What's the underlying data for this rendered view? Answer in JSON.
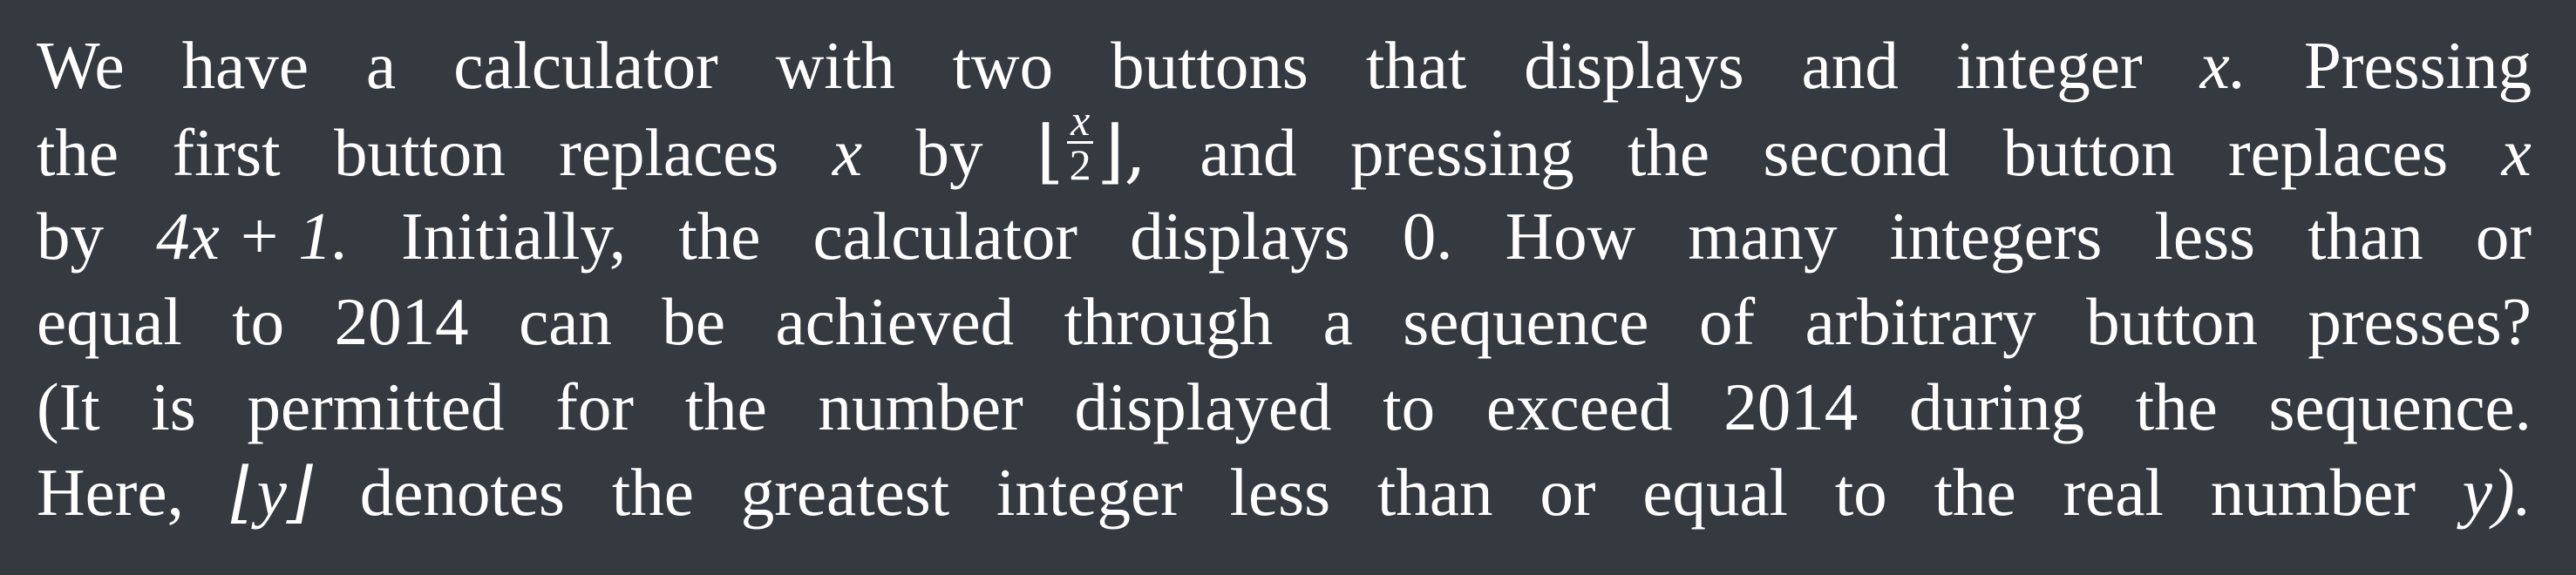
{
  "problem": {
    "line1": [
      "We",
      "have",
      "a",
      "calculator",
      "with",
      "two",
      "buttons",
      "that",
      "displays",
      "and",
      "integer",
      "x.",
      "Pressing"
    ],
    "line2": {
      "before": [
        "the",
        "first",
        "button",
        "replaces",
        "x",
        "by"
      ],
      "floor_open": "⌊",
      "frac_num": "x",
      "frac_den": "2",
      "floor_close": "⌋,",
      "after": [
        "and",
        "pressing",
        "the",
        "second",
        "button",
        "replaces",
        "x"
      ]
    },
    "line3": [
      "by",
      "4x + 1.",
      "Initially,",
      "the",
      "calculator",
      "displays",
      "0.",
      "How",
      "many",
      "integers",
      "less",
      "than",
      "or"
    ],
    "line4": [
      "equal",
      "to",
      "2014",
      "can",
      "be",
      "achieved",
      "through",
      "a",
      "sequence",
      "of",
      "arbitrary",
      "button",
      "presses?"
    ],
    "line5": [
      "(It",
      "is",
      "permitted",
      "for",
      "the",
      "number",
      "displayed",
      "to",
      "exceed",
      "2014",
      "during",
      "the",
      "sequence."
    ],
    "line6": [
      "Here,",
      "⌊y⌋",
      "denotes",
      "the",
      "greatest",
      "integer",
      "less",
      "than",
      "or",
      "equal",
      "to",
      "the",
      "real",
      "number",
      "y)."
    ]
  }
}
